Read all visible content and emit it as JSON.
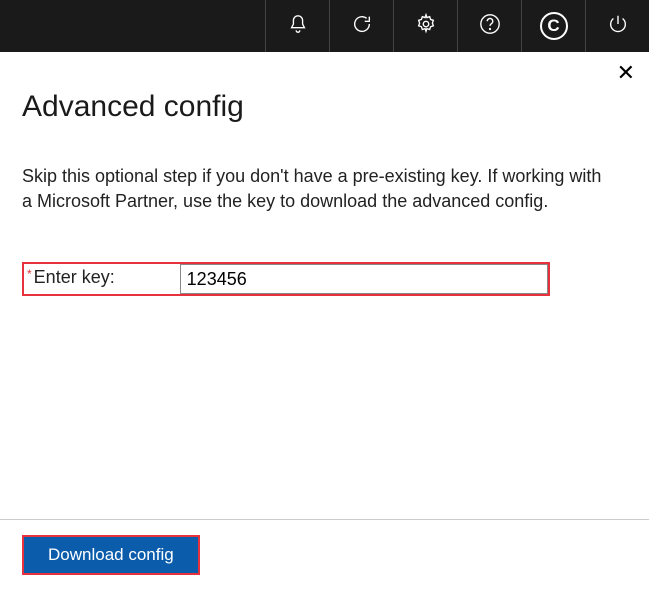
{
  "topbar": {
    "icons": [
      "bell",
      "refresh",
      "gear",
      "help",
      "copyright",
      "power"
    ]
  },
  "panel": {
    "title": "Advanced config",
    "description": "Skip this optional step if you don't have a pre-existing key. If working with a Microsoft Partner, use the key to download the advanced config.",
    "close_symbol": "✕"
  },
  "field": {
    "required_mark": "*",
    "label": "Enter key:",
    "value": "123456"
  },
  "actions": {
    "download_label": "Download config"
  }
}
